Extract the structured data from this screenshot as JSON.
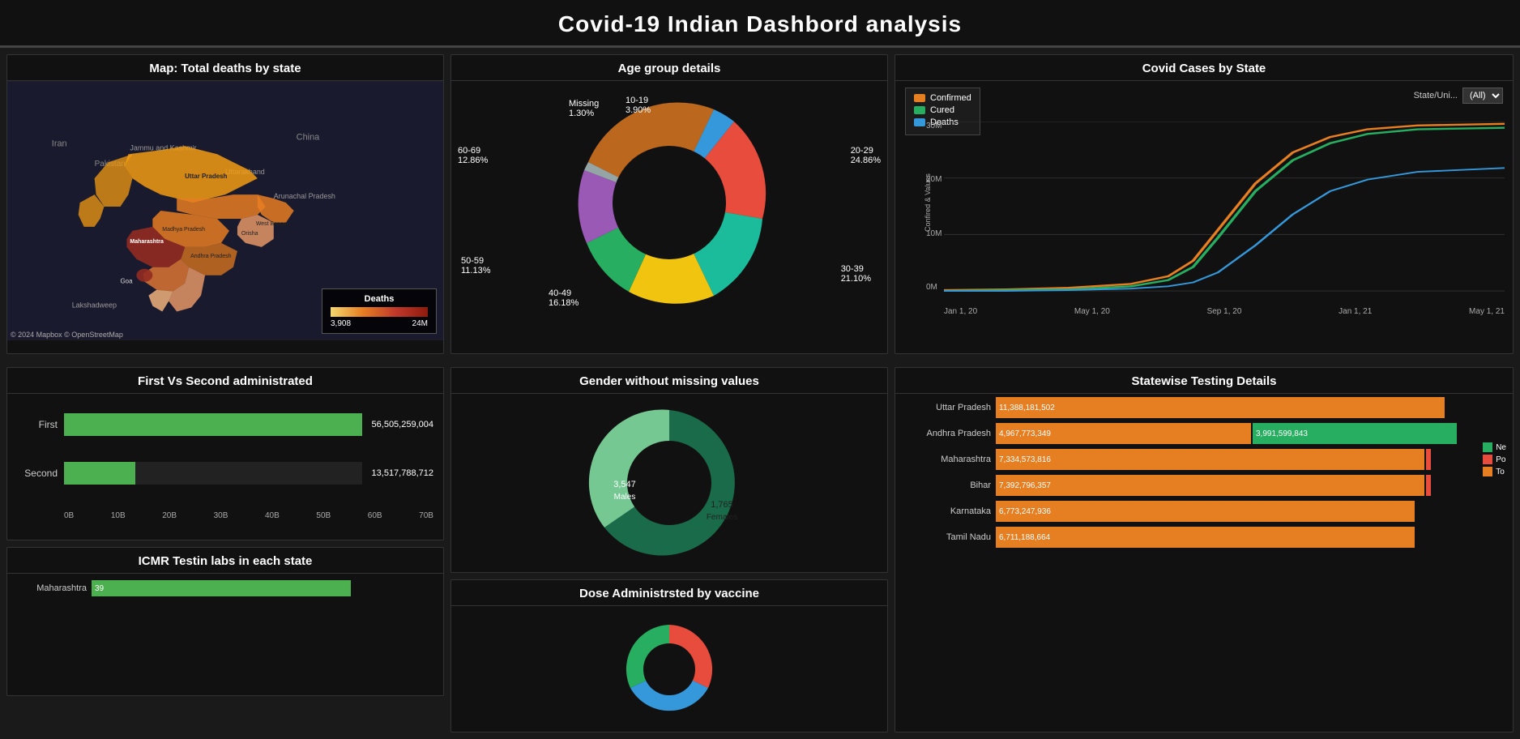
{
  "header": {
    "title": "Covid-19 Indian Dashbord analysis"
  },
  "map_panel": {
    "title": "Map: Total deaths by state",
    "legend_title": "Deaths",
    "legend_min": "3,908",
    "legend_max": "24M",
    "credit": "© 2024 Mapbox © OpenStreetMap",
    "states": [
      "Maharashtra",
      "Uttar Pradesh",
      "Madhya Pradesh",
      "West Bengal",
      "Andhra Pradesh",
      "Orisha",
      "Goa",
      "Lakshadweep",
      "Arunachal Pradesh",
      "Jammu and Kashmir",
      "Uttarakhand",
      "China",
      "Iran",
      "Pakistan"
    ]
  },
  "age_group": {
    "title": "Age group details",
    "segments": [
      {
        "label": "10-19",
        "value": "3.90%",
        "color": "#3498db"
      },
      {
        "label": "20-29",
        "value": "24.86%",
        "color": "#e74c3c"
      },
      {
        "label": "30-39",
        "value": "21.10%",
        "color": "#1abc9c"
      },
      {
        "label": "40-49",
        "value": "16.18%",
        "color": "#f1c40f"
      },
      {
        "label": "50-59",
        "value": "11.13%",
        "color": "#27ae60"
      },
      {
        "label": "60-69",
        "value": "12.86%",
        "color": "#9b59b6"
      },
      {
        "label": "Missing",
        "value": "1.30%",
        "color": "#95a5a6"
      }
    ]
  },
  "covid_cases": {
    "title": "Covid Cases by State",
    "y_label": "Confirmed & Values",
    "y_ticks": [
      "30M",
      "20M",
      "10M",
      "0M"
    ],
    "x_ticks": [
      "Jan 1, 20",
      "May 1, 20",
      "Sep 1, 20",
      "Jan 1, 21",
      "May 1, 21"
    ],
    "legend": [
      {
        "label": "Confirmed",
        "color": "#e67e22"
      },
      {
        "label": "Cured",
        "color": "#27ae60"
      },
      {
        "label": "Deaths",
        "color": "#3498db"
      }
    ],
    "filter_label": "State/Uni...",
    "filter_value": "(All)"
  },
  "vaccine_admin": {
    "title": "First Vs Second administrated",
    "bars": [
      {
        "label": "First",
        "value": "56,505,259,004",
        "pct": 100
      },
      {
        "label": "Second",
        "value": "13,517,788,712",
        "pct": 24
      }
    ],
    "x_ticks": [
      "0B",
      "10B",
      "20B",
      "30B",
      "40B",
      "50B",
      "60B",
      "70B"
    ]
  },
  "gender": {
    "title": "Gender without missing values",
    "segments": [
      {
        "label": "3,547\nMales",
        "value": 3547,
        "color": "#1a6b4a"
      },
      {
        "label": "1,765\nFemales",
        "value": 1765,
        "color": "#76c893"
      }
    ]
  },
  "statewise_testing": {
    "title": "Statewise Testing Details",
    "legend": [
      {
        "label": "Ne",
        "color": "#27ae60"
      },
      {
        "label": "Po",
        "color": "#e74c3c"
      },
      {
        "label": "To",
        "color": "#e67e22"
      }
    ],
    "rows": [
      {
        "state": "Uttar Pradesh",
        "orange_val": "11,388,181,502",
        "orange_pct": 95,
        "green_pct": 0,
        "pink": false
      },
      {
        "state": "Andhra Pradesh",
        "orange_val": "4,967,773,349",
        "orange_pct": 55,
        "green_val": "3,991,599,843",
        "green_pct": 44,
        "pink": false
      },
      {
        "state": "Maharashtra",
        "orange_val": "7,334,573,816",
        "orange_pct": 88,
        "green_pct": 0,
        "pink": true
      },
      {
        "state": "Bihar",
        "orange_val": "7,392,796,357",
        "orange_pct": 88,
        "green_pct": 0,
        "pink": true
      },
      {
        "state": "Karnataka",
        "orange_val": "6,773,247,936",
        "orange_pct": 85,
        "green_pct": 0,
        "pink": false
      },
      {
        "state": "Tamil Nadu",
        "orange_val": "6,711,188,664",
        "orange_pct": 84,
        "green_pct": 0,
        "pink": false
      }
    ]
  },
  "icmr_labs": {
    "title": "ICMR Testin labs in each state",
    "rows": [
      {
        "state": "Maharashtra",
        "value": 39,
        "pct": 100
      }
    ]
  },
  "dose_admin": {
    "title": "Dose Administrsted by vaccine"
  }
}
